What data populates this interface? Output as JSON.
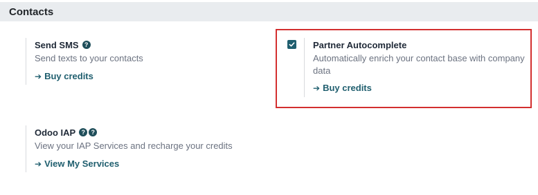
{
  "section": {
    "title": "Contacts"
  },
  "settings": {
    "send_sms": {
      "title": "Send SMS",
      "help_icon": "question-circle-icon",
      "description": "Send texts to your contacts",
      "link_label": "Buy credits",
      "link_icon": "arrow-right-icon"
    },
    "partner_autocomplete": {
      "checked": true,
      "title": "Partner Autocomplete",
      "description": "Automatically enrich your contact base with company data",
      "link_label": "Buy credits",
      "link_icon": "arrow-right-icon"
    },
    "odoo_iap": {
      "title": "Odoo IAP",
      "help_icons": [
        "question-circle-icon",
        "question-circle-icon"
      ],
      "description": "View your IAP Services and recharge your credits",
      "link_label": "View My Services",
      "link_icon": "arrow-right-icon"
    }
  },
  "colors": {
    "accent": "#1f5e6e",
    "highlight_border": "#d32f2f",
    "header_bg": "#e9ecef"
  }
}
